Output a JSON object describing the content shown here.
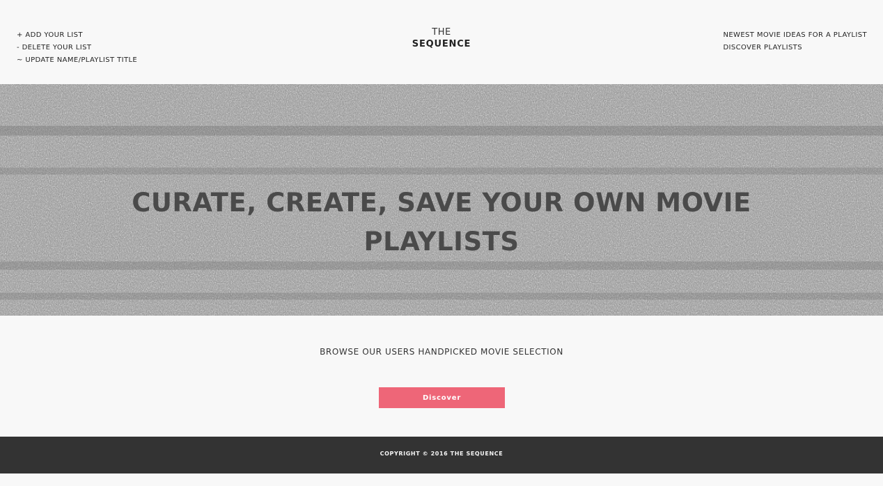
{
  "header": {
    "left_links": [
      "+ ADD YOUR LIST",
      "- DELETE YOUR LIST",
      "~ UPDATE NAME/PLAYLIST TITLE"
    ],
    "logo_top": "THE",
    "logo_bottom": "SEQUENCE",
    "right_links": [
      "NEWEST MOVIE IDEAS FOR A PLAYLIST",
      "DISCOVER PLAYLISTS"
    ]
  },
  "hero": {
    "title": "CURATE, CREATE, SAVE YOUR OWN MOVIE PLAYLISTS"
  },
  "browse": {
    "text": "BROWSE OUR USERS HANDPICKED MOVIE SELECTION",
    "button_label": "Discover",
    "button_color": "#ee6678"
  },
  "footer": {
    "copyright": "COPYRIGHT © 2016 THE SEQUENCE"
  },
  "colors": {
    "background": "#f8f8f8",
    "footer": "#333333",
    "accent": "#ee6678"
  }
}
